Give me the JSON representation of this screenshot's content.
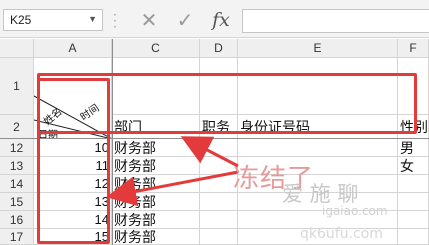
{
  "formula_bar": {
    "name_box": "K25",
    "cancel_glyph": "✕",
    "confirm_glyph": "✓",
    "fx_label": "fx",
    "formula": ""
  },
  "columns": [
    "A",
    "C",
    "D",
    "E",
    "F"
  ],
  "rows": [
    "1",
    "2",
    "12",
    "13",
    "14",
    "15",
    "16",
    "17"
  ],
  "header_row": {
    "diag_top": "时间",
    "diag_mid": "姓名",
    "diag_bottom": "日期",
    "c": "部门",
    "d": "职务",
    "e": "身份证号码",
    "f": "性别"
  },
  "data_rows": [
    {
      "row": "12",
      "a": "10",
      "c": "财务部",
      "f": "男"
    },
    {
      "row": "13",
      "a": "11",
      "c": "财务部",
      "f": "女"
    },
    {
      "row": "14",
      "a": "12",
      "c": "财务部",
      "f": ""
    },
    {
      "row": "15",
      "a": "13",
      "c": "财务部",
      "f": ""
    },
    {
      "row": "16",
      "a": "14",
      "c": "财务部",
      "f": ""
    },
    {
      "row": "17",
      "a": "15",
      "c": "财务部",
      "f": ""
    }
  ],
  "annotation": {
    "text": "冻结了",
    "color": "#e33b3b"
  },
  "watermark": {
    "brand": "爱 施 聊",
    "url": "igaiao.com",
    "bottom": "qk6ufu.com"
  }
}
